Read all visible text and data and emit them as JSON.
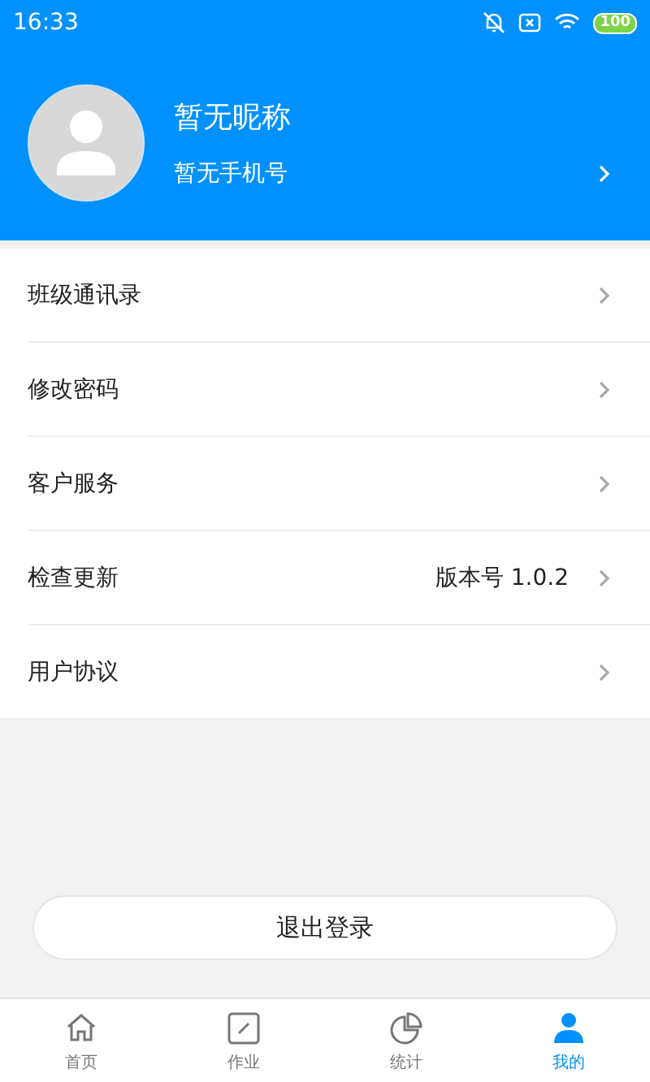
{
  "status_bar": {
    "time": "16:33",
    "battery": "100"
  },
  "profile": {
    "nickname": "暂无昵称",
    "phone": "暂无手机号"
  },
  "menu": [
    {
      "label": "班级通讯录"
    },
    {
      "label": "修改密码"
    },
    {
      "label": "客户服务"
    },
    {
      "label": "检查更新",
      "value": "版本号 1.0.2"
    },
    {
      "label": "用户协议"
    }
  ],
  "logout_button": "退出登录",
  "tabs": [
    {
      "kind": "home",
      "label": "首页",
      "selected": false
    },
    {
      "kind": "homework",
      "label": "作业",
      "selected": false
    },
    {
      "kind": "stats",
      "label": "统计",
      "selected": false
    },
    {
      "kind": "me",
      "label": "我的",
      "selected": true
    }
  ]
}
